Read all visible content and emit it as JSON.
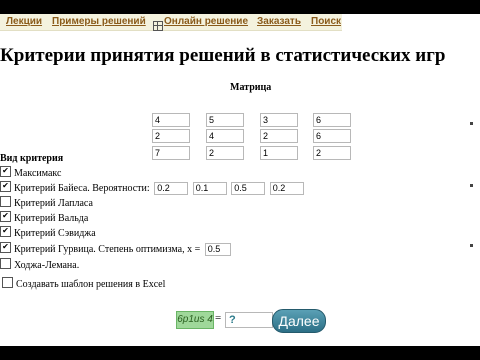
{
  "nav": {
    "items": [
      "Лекции",
      "Примеры решений",
      "Онлайн решение",
      "Заказать",
      "Поиск"
    ]
  },
  "page_title": "Критерии принятия решений в статистических игр",
  "matrix": {
    "title": "Матрица",
    "rows": [
      [
        "4",
        "5",
        "3",
        "6"
      ],
      [
        "2",
        "4",
        "2",
        "6"
      ],
      [
        "7",
        "2",
        "1",
        "2"
      ]
    ]
  },
  "criteria": {
    "title": "Вид критерия",
    "items": [
      {
        "label": "Максимакс",
        "checked": true
      },
      {
        "label": "Критерий Байеса. Вероятности:",
        "checked": true,
        "values": [
          "0.2",
          "0.1",
          "0.5",
          "0.2"
        ]
      },
      {
        "label": "Критерий Лапласа",
        "checked": false
      },
      {
        "label": "Критерий Вальда",
        "checked": true
      },
      {
        "label": "Критерий Сэвиджа",
        "checked": true
      },
      {
        "label": "Критерий Гурвица. Степень оптимизма, x =",
        "checked": true,
        "value": "0.5"
      },
      {
        "label": "Ходжа-Лемана.",
        "checked": false
      }
    ]
  },
  "excel_label": "Создавать шаблон решения в Excel",
  "captcha": {
    "text": "6p1us 4",
    "equals": "=",
    "answer": "?"
  },
  "submit_label": "Далее"
}
